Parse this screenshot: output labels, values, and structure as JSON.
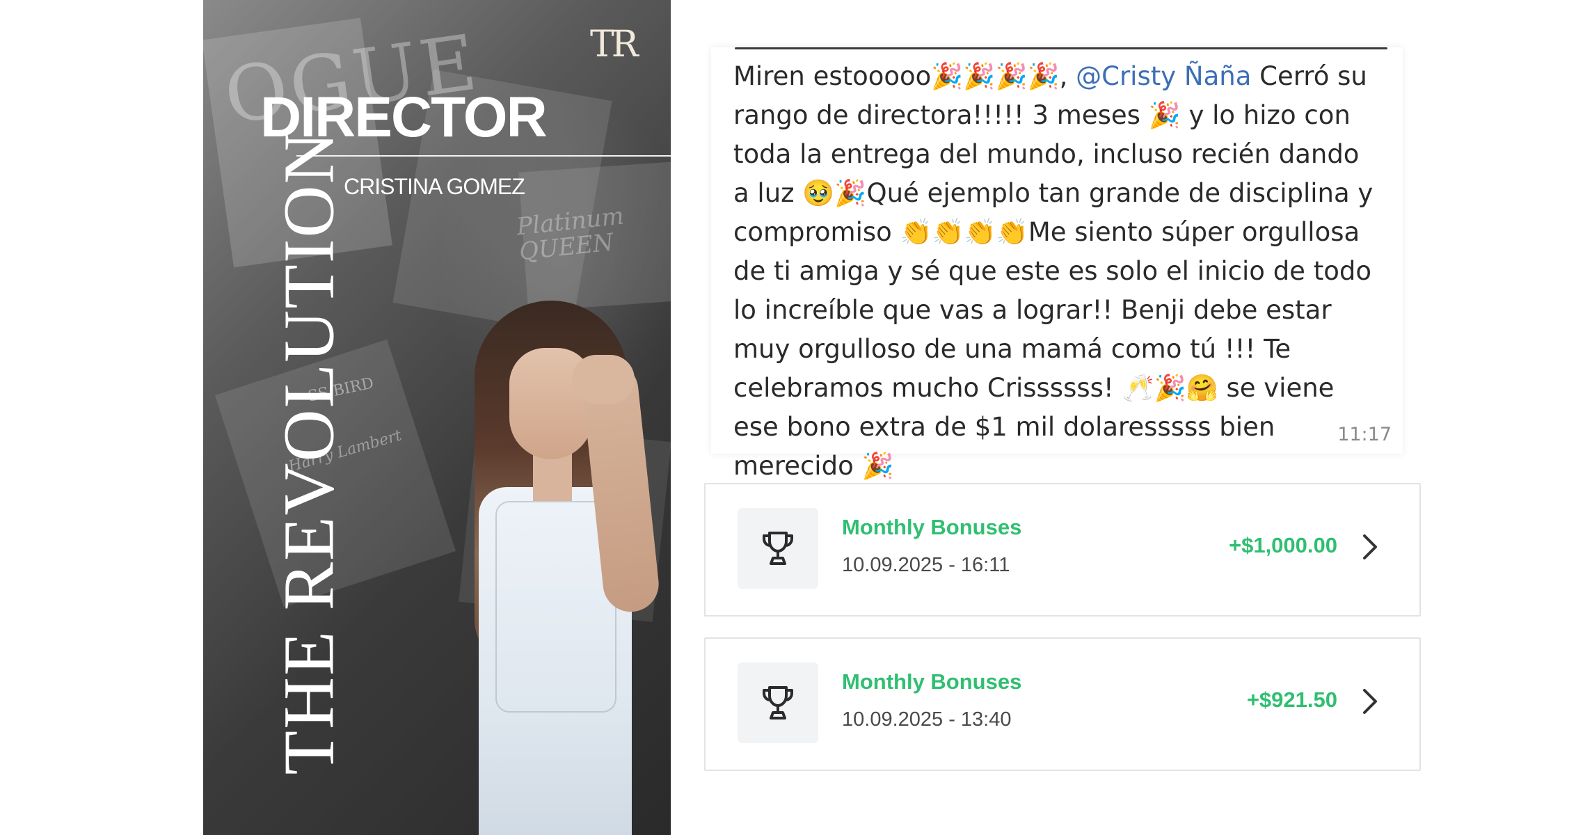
{
  "poster": {
    "logo": "TR",
    "heading": "DIRECTOR",
    "name": "CRISTINA GOMEZ",
    "vertical_title": "THE REVOLUTION",
    "magazine_texts": {
      "vogue": "OGUE",
      "platinum": "Platinum QUEEN",
      "bird": "SS BIRD",
      "harry": "Harry Lambert"
    }
  },
  "chat": {
    "text_before": "Miren estooooo🎉🎉🎉🎉, ",
    "mention": "@Cristy Ñaña",
    "text_after": " Cerró su rango de directora!!!!! 3 meses 🎉 y lo hizo con toda la entrega del mundo, incluso recién dando a luz 🥹🎉Qué ejemplo tan grande de disciplina y compromiso 👏👏👏👏Me siento súper orgullosa de ti amiga y sé que este es solo el inicio de todo lo increíble que vas a lograr!! Benji debe estar muy orgulloso de una mamá como tú !!! Te celebramos mucho Crissssss! 🥂🎉🤗 se viene ese bono extra de $1 mil dolaresssss bien merecido 🎉",
    "time": "11:17"
  },
  "transactions": [
    {
      "title": "Monthly Bonuses",
      "date": "10.09.2025 - 16:11",
      "amount": "+$1,000.00",
      "icon": "trophy-icon"
    },
    {
      "title": "Monthly Bonuses",
      "date": "10.09.2025 - 13:40",
      "amount": "+$921.50",
      "icon": "trophy-icon"
    }
  ],
  "colors": {
    "accent_green": "#2fbf71",
    "mention_blue": "#3d6fb6"
  }
}
